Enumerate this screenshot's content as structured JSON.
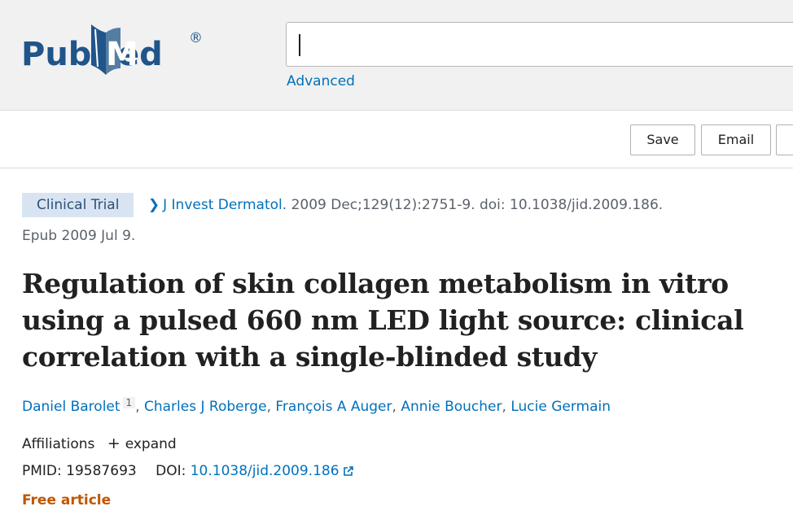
{
  "header": {
    "logo_text": "PubMed",
    "search": {
      "value": "",
      "placeholder": ""
    },
    "advanced_label": "Advanced"
  },
  "actions": {
    "save_label": "Save",
    "email_label": "Email"
  },
  "article": {
    "badge": "Clinical Trial",
    "journal": "J Invest Dermatol.",
    "citation": " 2009 Dec;129(12):2751-9. doi: 10.1038/jid.2009.186.",
    "epub": "Epub 2009 Jul 9.",
    "title": "Regulation of skin collagen metabolism in vitro using a pulsed 660 nm LED light source: clinical correlation with a single-blinded study",
    "authors": [
      {
        "name": "Daniel Barolet",
        "aff": "1"
      },
      {
        "name": "Charles J Roberge"
      },
      {
        "name": "François A Auger"
      },
      {
        "name": "Annie Boucher"
      },
      {
        "name": "Lucie Germain"
      }
    ],
    "affiliations_label": "Affiliations",
    "expand_label": "expand",
    "pmid_label": "PMID:",
    "pmid": "19587693",
    "doi_label": "DOI:",
    "doi": "10.1038/jid.2009.186",
    "free_label": "Free article"
  },
  "colors": {
    "link": "#0071bc",
    "badge_bg": "#d8e4f2",
    "free": "#c05600",
    "logo_blue": "#20558a",
    "header_bg": "#f1f1f1"
  },
  "icons": [
    "pubmed-logo-icon",
    "chevron-right-icon",
    "plus-icon",
    "external-link-icon"
  ]
}
